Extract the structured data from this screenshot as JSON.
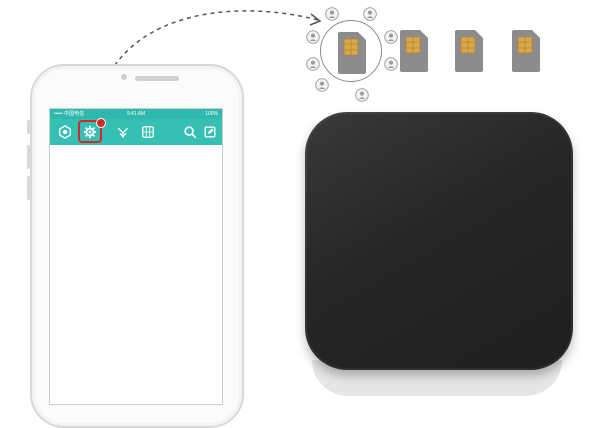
{
  "status_bar": {
    "left": "••••• 中国电信",
    "time": "9:41 AM",
    "right": "100%"
  },
  "toolbar": {
    "icons": [
      "hexagon-icon",
      "gear-icon",
      "signal-icon",
      "sim-card-icon",
      "search-icon",
      "edit-icon"
    ],
    "active_index": 1
  },
  "sim_cards": {
    "count": 4,
    "selected_index": 0
  },
  "users": {
    "count": 8
  },
  "colors": {
    "toolbar": "#36c0b4",
    "highlight": "#d12a2a",
    "device": "#262626",
    "sim_body": "#8c8c8c",
    "chip": "#d9a84a"
  }
}
